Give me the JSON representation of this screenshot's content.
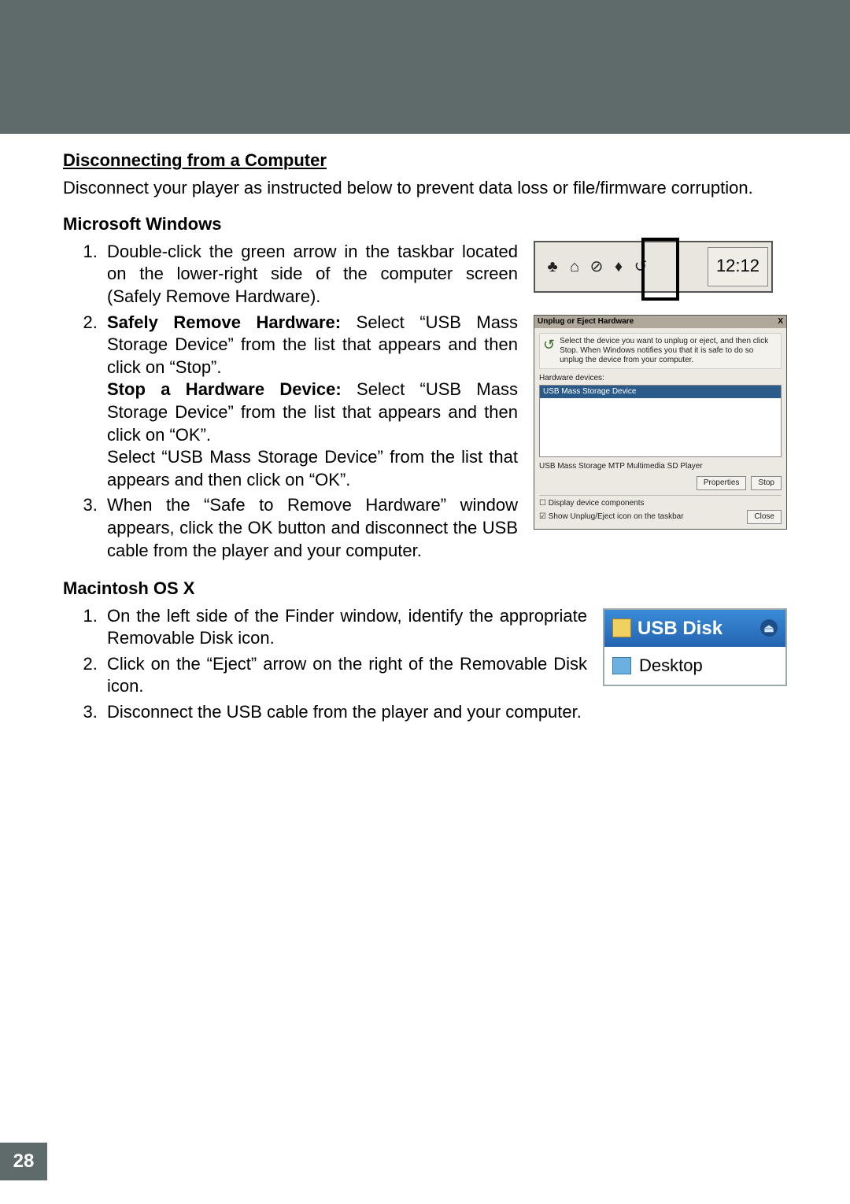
{
  "page_number": "28",
  "title": "Disconnecting from a Computer",
  "intro": "Disconnect your player as instructed below to prevent data loss or file/firmware corruption.",
  "windows": {
    "title": "Microsoft Windows",
    "item1": "Double-click the green arrow in the taskbar located on the lower-right side of the computer screen (Safely Remove Hardware).",
    "item2_label": "Safely Remove Hardware:",
    "item2_a": "Select “USB Mass Storage Device” from the list that appears and then click on “Stop”.",
    "item2_b_label": "Stop a Hardware Device:",
    "item2_b": " Select “USB Mass Storage Device” from the list that appears and then click on “OK”.",
    "item2_c": "Select “USB Mass Storage Device” from the list that appears and then click on “OK”.",
    "item3": "When the “Safe to Remove Hardware” window appears, click the OK button and disconnect the USB cable from the player and your computer."
  },
  "mac": {
    "title": "Macintosh OS X",
    "item1": "On the left side of the Finder window, identify the appropriate Removable Disk icon.",
    "item2": "Click on the “Eject” arrow on the right of the Removable Disk icon.",
    "item3": "Disconnect the USB cable from the player and your computer."
  },
  "taskbar": {
    "clock": "12:12"
  },
  "dialog": {
    "title": "Unplug or Eject Hardware",
    "close": "X",
    "instruction": "Select the device you want to unplug or eject, and then click Stop. When Windows notifies you that it is safe to do so unplug the device from your computer.",
    "hardware_label": "Hardware devices:",
    "selected_item": "USB Mass Storage Device",
    "description": "USB Mass Storage MTP Multimedia SD Player",
    "btn_properties": "Properties",
    "btn_stop": "Stop",
    "chk1": "Display device components",
    "chk2": "Show Unplug/Eject icon on the taskbar",
    "btn_close": "Close"
  },
  "mac_panel": {
    "usb_label": "USB Disk",
    "desktop_label": "Desktop"
  }
}
